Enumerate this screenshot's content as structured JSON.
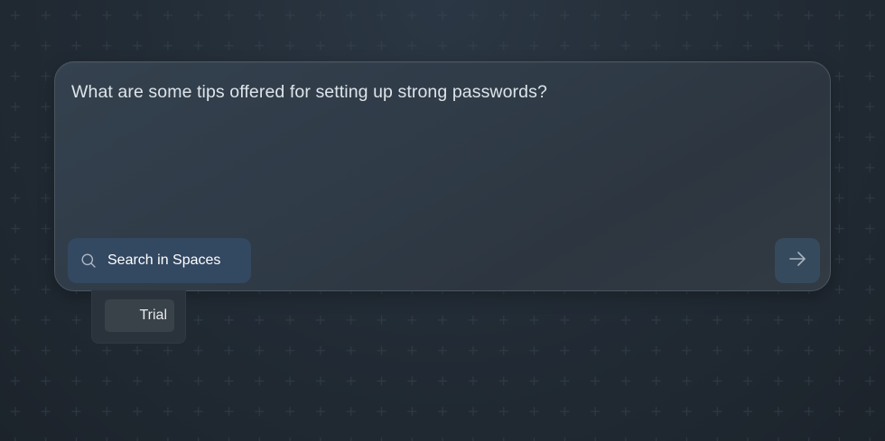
{
  "query": {
    "text": "What are some tips offered for setting up strong passwords?"
  },
  "search_spaces": {
    "label": "Search in Spaces",
    "icon": "search-icon"
  },
  "submit": {
    "icon": "arrow-right-icon"
  },
  "spaces_dropdown": {
    "items": [
      {
        "label": "Trial"
      }
    ]
  },
  "colors": {
    "background": "#232d37",
    "card": "#303c48",
    "search_button": "#334861",
    "submit_button": "#364a5e",
    "text": "#dde4ea"
  }
}
